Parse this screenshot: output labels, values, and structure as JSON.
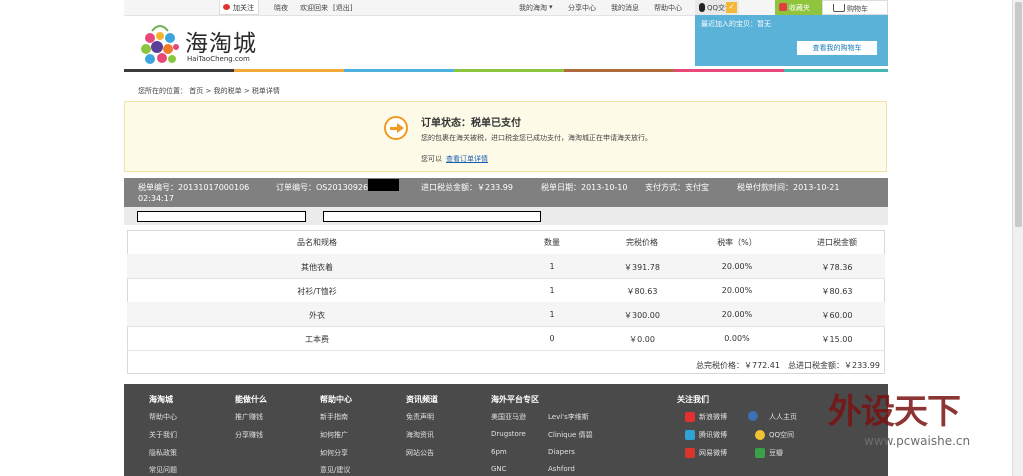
{
  "topbar": {
    "follow": "加关注",
    "hello": "晓夜",
    "welcome": "欢迎回来",
    "logout": "[退出]",
    "my_haitao": "我的海淘",
    "share_center": "分享中心",
    "my_messages": "我的消息",
    "help_center": "帮助中心",
    "qq_chat": "QQ交谈",
    "favorite": "收藏夹",
    "cart": "购物车",
    "caret": "▾"
  },
  "cart_panel": {
    "text": "最近加入的宝贝：暂无",
    "button": "查看我的购物车"
  },
  "logo": {
    "name": "海淘城",
    "domain": "HaiTaoCheng.com"
  },
  "breadcrumb": {
    "prefix": "您所在的位置：",
    "home": "首页",
    "sep": ">",
    "my_tax": "我的税单",
    "detail": "税单详情"
  },
  "status": {
    "title": "订单状态：税单已支付",
    "desc": "您的包裹在海关被税，进口税金您已成功支付，海淘城正在申请海关放行。",
    "view_prefix": "您可以",
    "view_link": "查看订单详情"
  },
  "info": {
    "tax_no": "税单编号：20131017000106",
    "order_no": "订单编号：OS20130926",
    "tax_total": "进口税总金额：￥233.99",
    "tax_date": "税单日期：2013-10-10",
    "pay_method": "支付方式：支付宝",
    "pay_time": "税单付款时间：2013-10-21",
    "pay_time2": "02:34:17"
  },
  "table": {
    "headers": [
      "品名和规格",
      "数量",
      "完税价格",
      "税率（%）",
      "进口税金额"
    ],
    "rows": [
      [
        "其他衣着",
        "1",
        "￥391.78",
        "20.00%",
        "￥78.36"
      ],
      [
        "衬衫/T恤衫",
        "1",
        "￥80.63",
        "20.00%",
        "￥80.63"
      ],
      [
        "外衣",
        "1",
        "￥300.00",
        "20.00%",
        "￥60.00"
      ],
      [
        "工本费",
        "0",
        "￥0.00",
        "0.00%",
        "￥15.00"
      ]
    ],
    "total_price": "总完税价格：￥772.41",
    "total_tax": "总进口税金额：￥233.99"
  },
  "footer": {
    "columns": [
      {
        "head": "海淘城",
        "items": [
          "帮助中心",
          "关于我们",
          "隐私政策",
          "常见问题"
        ]
      },
      {
        "head": "能做什么",
        "items": [
          "推广赚钱",
          "分享赚钱"
        ]
      },
      {
        "head": "帮助中心",
        "items": [
          "新手指南",
          "如何推广",
          "如何分享",
          "意见/建议"
        ]
      },
      {
        "head": "资讯频道",
        "items": [
          "免责声明",
          "海淘资讯",
          "网站公告"
        ]
      },
      {
        "head": "海外平台专区",
        "items": [
          "美国亚马逊",
          "Drugstore",
          "6pm",
          "GNC"
        ]
      },
      {
        "head": "",
        "items": [
          "Levi's李维斯",
          "Clinique 倩碧",
          "Diapers",
          "Ashford"
        ]
      }
    ],
    "follow_head": "关注我们",
    "social": [
      "新浪微博",
      "腾讯微博",
      "网易微博",
      "人人主页",
      "QQ空间",
      "豆瓣"
    ]
  },
  "watermark": {
    "big": "外设天下",
    "url": "www.pcwaishe.cn"
  },
  "colors": {
    "info_bar": "#808080",
    "footer": "#4a4a4a",
    "cart_panel": "#5bb2d8",
    "accent_orange": "#f09a22"
  }
}
